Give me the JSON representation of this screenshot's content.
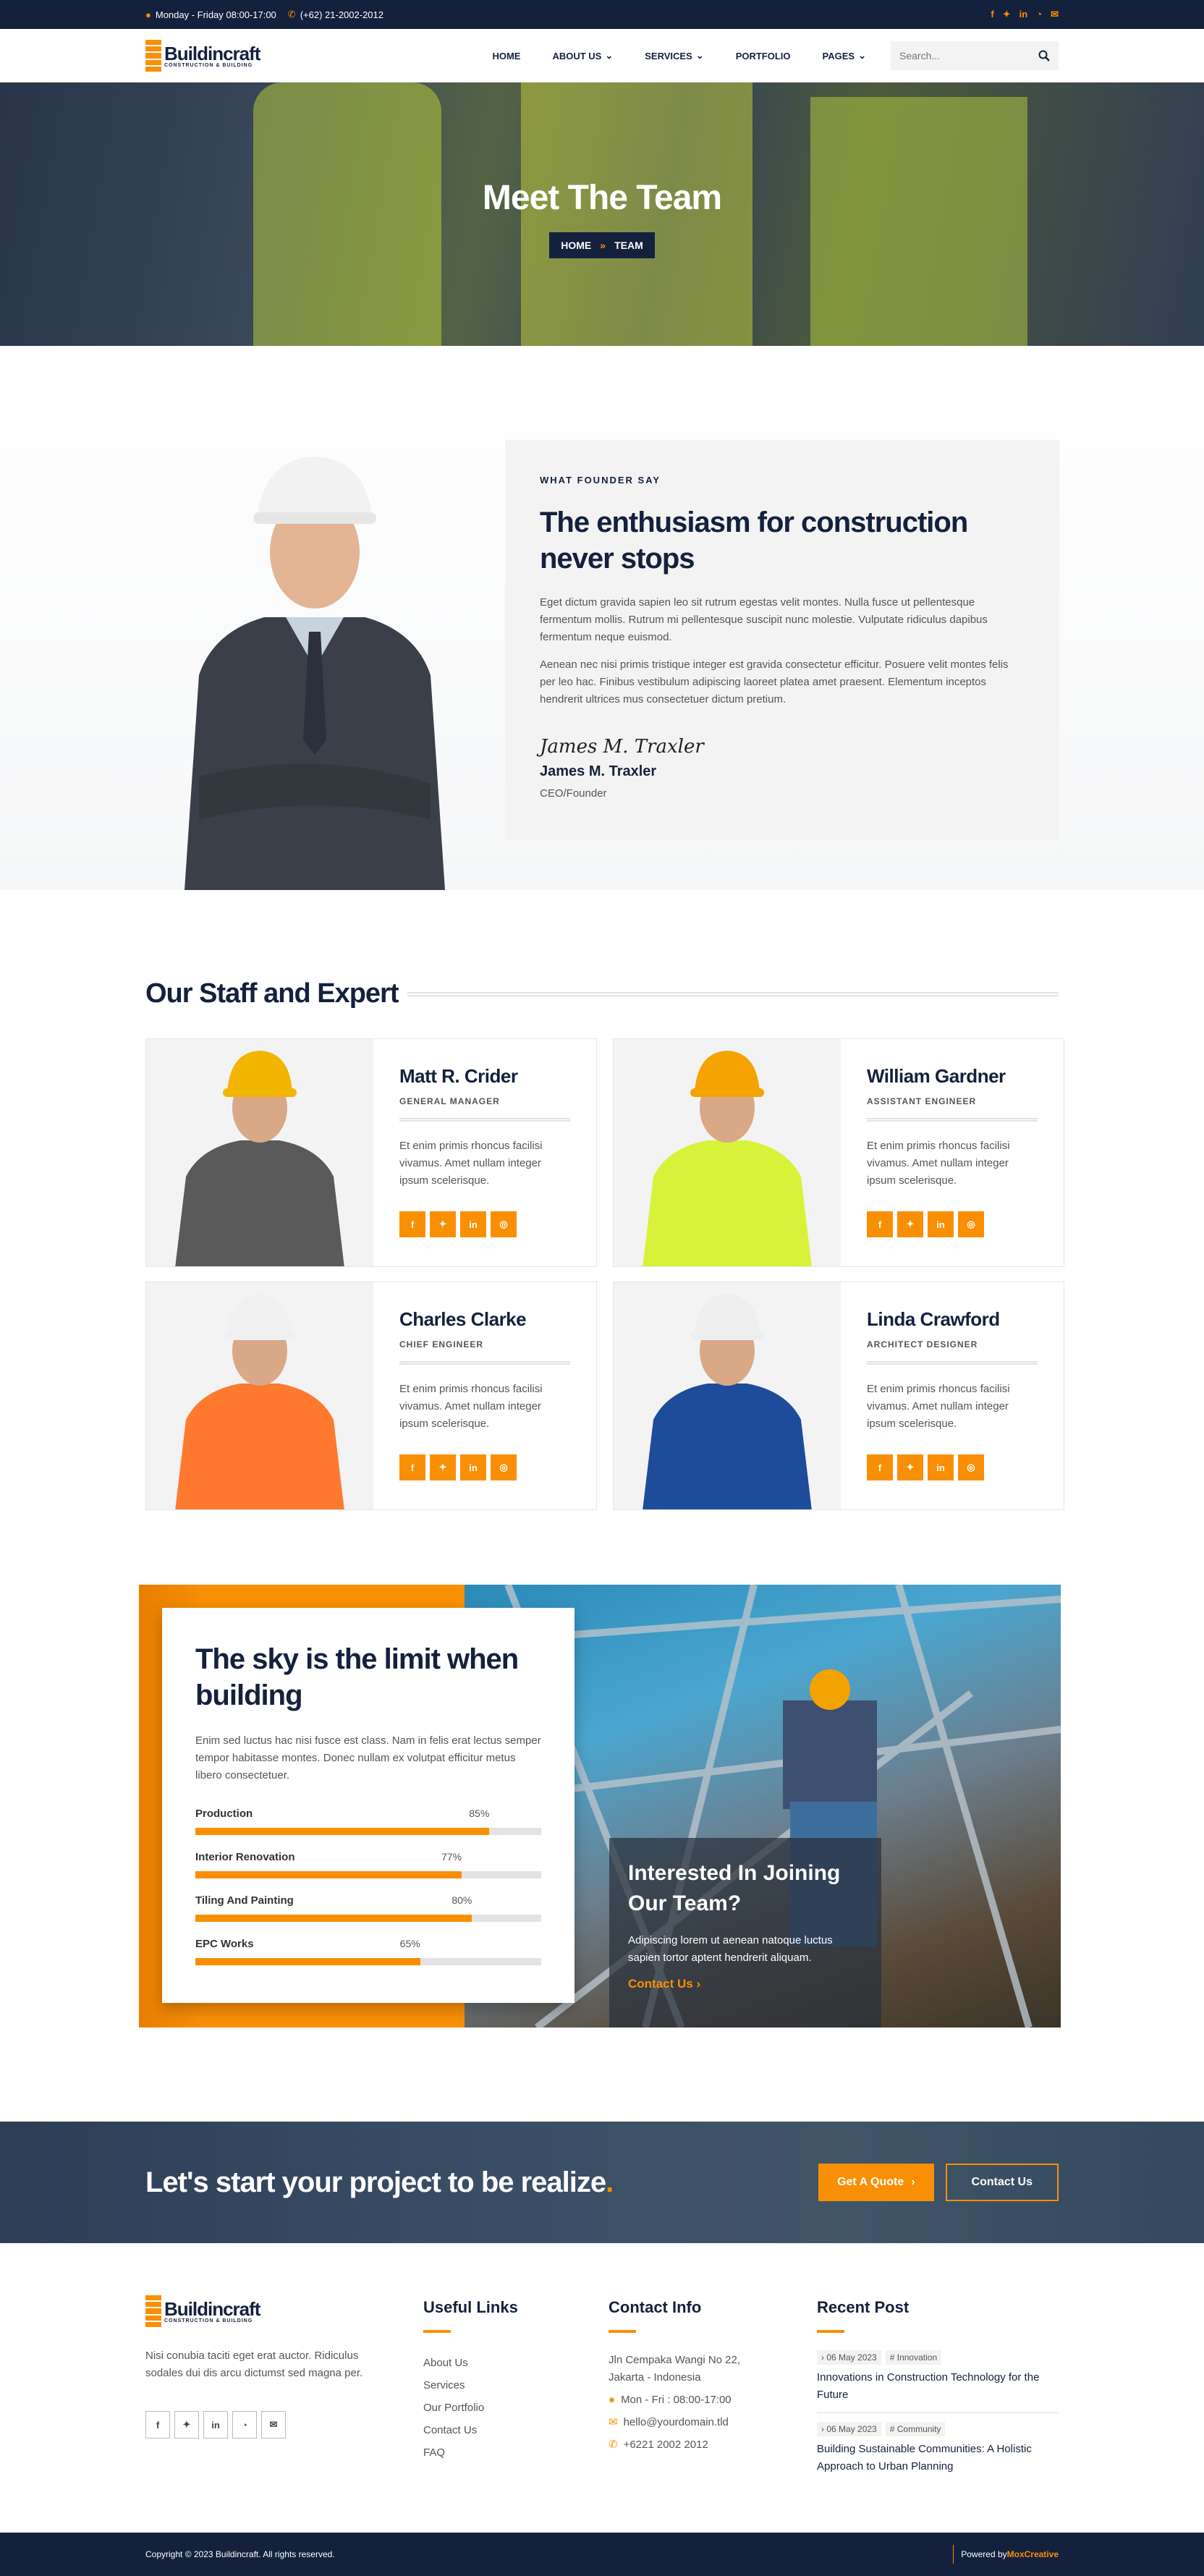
{
  "topbar": {
    "hours": "Monday - Friday 08:00-17:00",
    "phone": "(+62) 21-2002-2012",
    "social": [
      "facebook-icon",
      "twitter-icon",
      "linkedin-icon",
      "rss-icon",
      "email-icon"
    ],
    "social_glyphs": [
      "f",
      "t",
      "in",
      "rss",
      "@"
    ]
  },
  "brand": {
    "name": "Buildincraft",
    "tagline": "CONSTRUCTION & BUILDING",
    "accent": "#f98f05",
    "navy": "#14213d"
  },
  "nav": {
    "items": [
      {
        "label": "HOME",
        "dropdown": false
      },
      {
        "label": "ABOUT US",
        "dropdown": true
      },
      {
        "label": "SERVICES",
        "dropdown": true
      },
      {
        "label": "PORTFOLIO",
        "dropdown": false
      },
      {
        "label": "PAGES",
        "dropdown": true
      }
    ],
    "search_placeholder": "Search..."
  },
  "hero": {
    "title": "Meet The Team",
    "breadcrumb": [
      "HOME",
      "TEAM"
    ],
    "breadcrumb_sep": "»"
  },
  "founder": {
    "eyebrow": "WHAT FOUNDER SAY",
    "title": "The enthusiasm for construction never stops",
    "paragraphs": [
      "Eget dictum gravida sapien leo sit rutrum egestas velit montes. Nulla fusce ut pellentesque fermentum mollis. Rutrum mi pellentesque suscipit nunc molestie. Vulputate ridiculus dapibus fermentum neque euismod.",
      "Aenean nec nisi primis tristique integer est gravida consectetur efficitur. Posuere velit montes felis per leo hac. Finibus vestibulum adipiscing laoreet platea amet praesent. Elementum inceptos hendrerit ultrices mus consectetuer dictum pretium."
    ],
    "signature": "James M. Traxler",
    "name": "James M. Traxler",
    "role": "CEO/Founder"
  },
  "staff": {
    "title": "Our Staff and Expert",
    "members": [
      {
        "name": "Matt R. Crider",
        "role": "GENERAL MANAGER",
        "bio": "Et enim primis rhoncus facilisi vivamus. Amet nullam integer ipsum scelerisque.",
        "helmet": "#f2b600",
        "shirt": "#5a5a5a"
      },
      {
        "name": "William Gardner",
        "role": "ASSISTANT ENGINEER",
        "bio": "Et enim primis rhoncus facilisi vivamus. Amet nullam integer ipsum scelerisque.",
        "helmet": "#f5a300",
        "shirt": "#d8f23a"
      },
      {
        "name": "Charles Clarke",
        "role": "CHIEF ENGINEER",
        "bio": "Et enim primis rhoncus facilisi vivamus. Amet nullam integer ipsum scelerisque.",
        "helmet": "#f0f0f0",
        "shirt": "#ff7a2e"
      },
      {
        "name": "Linda Crawford",
        "role": "ARCHITECT DESIGNER",
        "bio": "Et enim primis rhoncus facilisi vivamus. Amet nullam integer ipsum scelerisque.",
        "helmet": "#eeeeee",
        "shirt": "#1e4c9a"
      }
    ],
    "social_glyphs": [
      "f",
      "t",
      "in",
      "ig"
    ]
  },
  "sky": {
    "title": "The sky is the limit when building",
    "text": "Enim sed luctus hac nisi fusce est class. Nam in felis erat lectus semper tempor habitasse montes. Donec nullam ex volutpat efficitur metus libero consectetuer.",
    "skills": [
      {
        "label": "Production",
        "percent": 85,
        "display": "85%"
      },
      {
        "label": "Interior Renovation",
        "percent": 77,
        "display": "77%"
      },
      {
        "label": "Tiling And Painting",
        "percent": 80,
        "display": "80%"
      },
      {
        "label": "EPC Works",
        "percent": 65,
        "display": "65%"
      }
    ],
    "join": {
      "title": "Interested In Joining Our Team?",
      "text": "Adipiscing lorem ut aenean natoque luctus sapien tortor aptent hendrerit aliquam.",
      "link": "Contact Us ›"
    }
  },
  "cta": {
    "title": "Let's start your project to be realize",
    "dot": ".",
    "primary": "Get A Quote",
    "primary_arrow": "›",
    "secondary": "Contact Us"
  },
  "footer": {
    "about": "Nisi conubia taciti eget erat auctor. Ridiculus sodales dui dis arcu dictumst sed magna per.",
    "social_glyphs": [
      "f",
      "t",
      "in",
      "rss",
      "@"
    ],
    "useful": {
      "title": "Useful Links",
      "links": [
        "About Us",
        "Services",
        "Our Portfolio",
        "Contact Us",
        "FAQ"
      ]
    },
    "contact": {
      "title": "Contact Info",
      "address": "Jln Cempaka Wangi No 22, Jakarta - Indonesia",
      "hours": "Mon - Fri : 08:00-17:00",
      "email": "hello@yourdomain.tld",
      "phone": "+6221 2002 2012"
    },
    "recent": {
      "title": "Recent Post",
      "posts": [
        {
          "date": "06 May 2023",
          "tag": "Innovation",
          "title": "Innovations in Construction Technology for the Future"
        },
        {
          "date": "06 May 2023",
          "tag": "Community",
          "title": "Building Sustainable Communities: A Holistic Approach to Urban Planning"
        }
      ]
    },
    "copyright": "Copyright © 2023 Buildincraft. All rights reserved.",
    "powered_prefix": "Powered by ",
    "powered_brand": "MoxCreative"
  }
}
